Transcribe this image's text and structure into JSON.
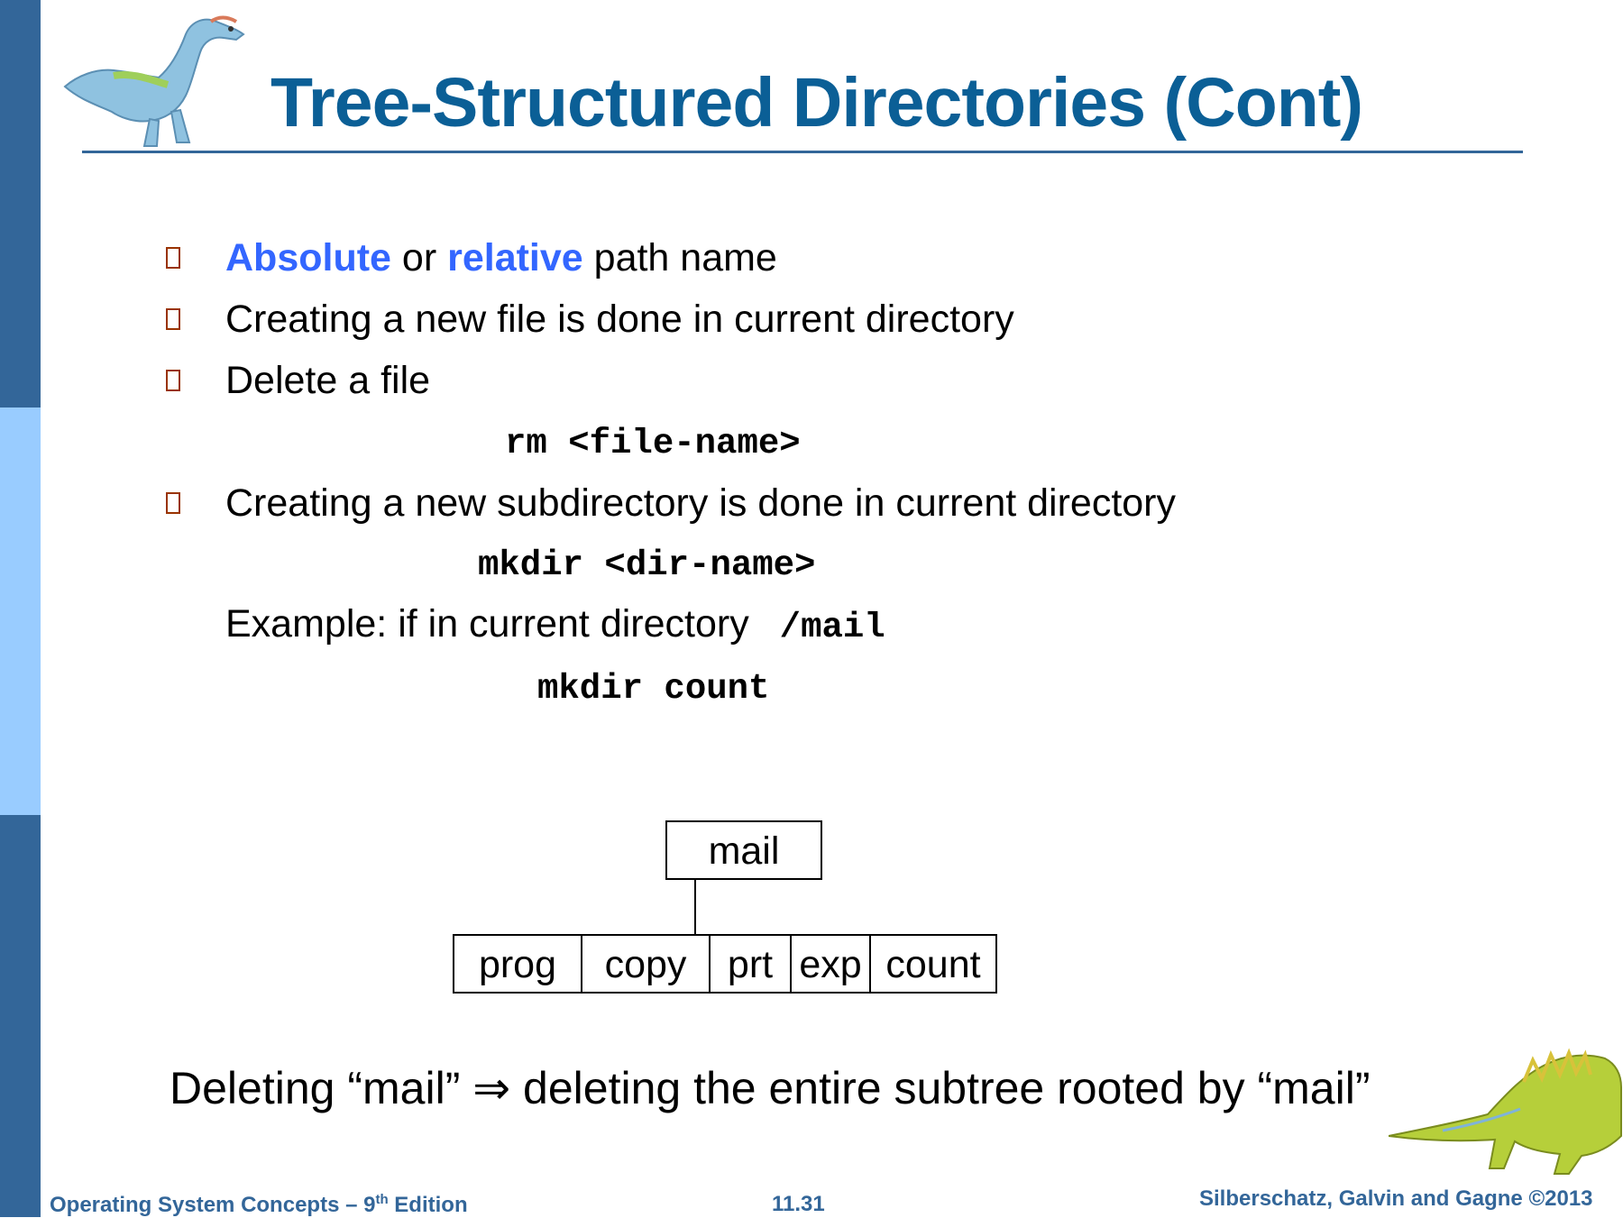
{
  "slide": {
    "title": "Tree-Structured Directories (Cont)",
    "bullets": [
      {
        "kw1": "Absolute",
        "mid": " or ",
        "kw2": "relative",
        "rest": " path name"
      },
      {
        "text": "Creating a new file is done in current directory"
      },
      {
        "text": "Delete a file"
      },
      {
        "text": "Creating a new subdirectory is done in current directory"
      }
    ],
    "commands": {
      "rm": "rm <file-name>",
      "mkdir": "mkdir <dir-name>",
      "example_label": "Example:  if in current directory ",
      "example_path": "/mail",
      "example_cmd": "mkdir count"
    },
    "tree": {
      "root": "mail",
      "children": [
        "prog",
        "copy",
        "prt",
        "exp",
        "count"
      ]
    },
    "bottom_statement": {
      "q_open1": "“",
      "w1": "mail",
      "q_close1": "”",
      "pre": "Deleting ",
      "arrow": "⇒",
      "mid": " deleting the entire subtree rooted by ",
      "w2": "mail"
    }
  },
  "footer": {
    "left_main": "Operating System Concepts  – 9",
    "left_sup": "th",
    "left_tail": " Edition",
    "page": "11.31",
    "right": "Silberschatz, Galvin and Gagne ©2013"
  },
  "colors": {
    "title": "#0b5f96",
    "keyword": "#3366ff",
    "bullet": "#993300",
    "sidebar_dark": "#336699",
    "sidebar_light": "#99ccff"
  },
  "icons": [
    "dinosaur-top-left",
    "dinosaur-bottom-right"
  ]
}
